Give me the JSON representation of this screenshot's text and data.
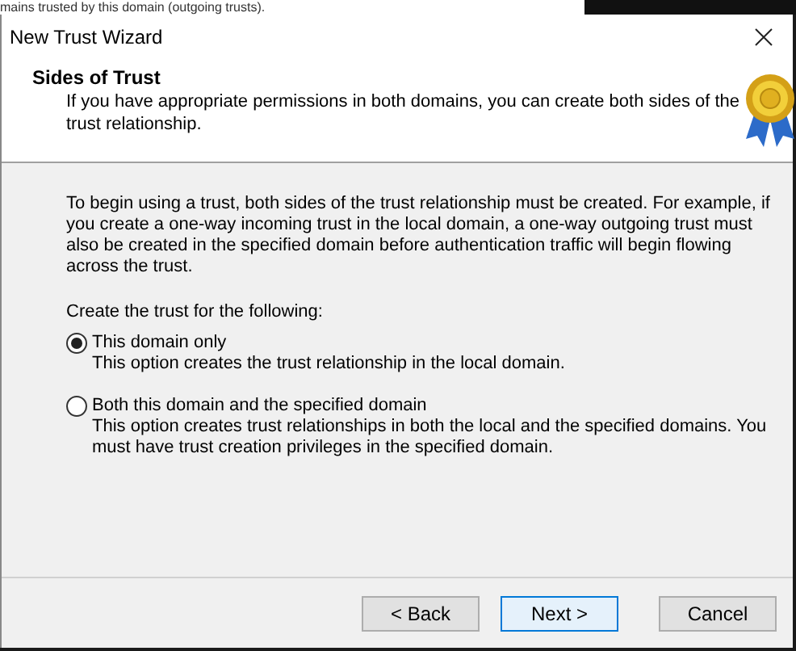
{
  "background_window": {
    "text": "mains trusted by this domain (outgoing trusts)."
  },
  "window": {
    "title": "New Trust Wizard"
  },
  "header": {
    "title": "Sides of Trust",
    "subtitle": "If you have appropriate permissions in both domains, you can create both sides of the trust relationship."
  },
  "intro": "To begin using a trust, both sides of the trust relationship must be created. For example, if you create a one-way incoming trust in the local domain, a one-way outgoing trust must also be created in the specified domain before authentication traffic will begin flowing across the trust.",
  "prompt": "Create the trust for the following:",
  "options": [
    {
      "label": "This domain only",
      "description": "This option creates the trust relationship in the local domain.",
      "selected": true
    },
    {
      "label": "Both this domain and the specified domain",
      "description": "This option creates trust relationships in both the local and the specified domains. You must have trust creation privileges in the specified domain.",
      "selected": false
    }
  ],
  "buttons": [
    {
      "label": "< Back",
      "default": false
    },
    {
      "label": "Next >",
      "default": true
    },
    {
      "label": "Cancel",
      "default": false
    }
  ]
}
